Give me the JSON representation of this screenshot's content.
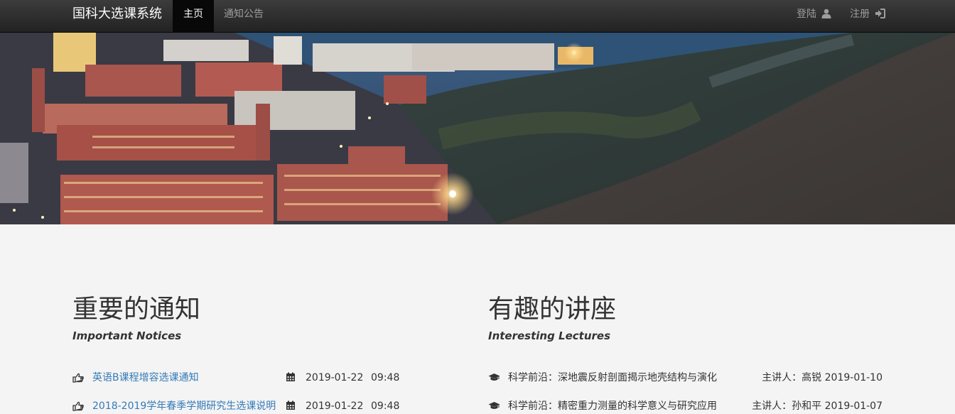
{
  "navbar": {
    "brand": "国科大选课系统",
    "items": [
      {
        "label": "主页",
        "active": true
      },
      {
        "label": "通知公告",
        "active": false
      }
    ],
    "login_label": "登陆",
    "register_label": "注册"
  },
  "notices": {
    "title": "重要的通知",
    "subtitle": "Important Notices",
    "items": [
      {
        "title": "英语B课程增容选课通知",
        "date": "2019-01-22",
        "time": "09:48"
      },
      {
        "title": "2018-2019学年春季学期研究生选课说明",
        "date": "2019-01-22",
        "time": "09:48"
      }
    ]
  },
  "lectures": {
    "title": "有趣的讲座",
    "subtitle": "Interesting Lectures",
    "items": [
      {
        "title": "科学前沿：深地震反射剖面揭示地壳结构与演化",
        "meta": "主讲人：高锐 2019-01-10"
      },
      {
        "title": "科学前沿：精密重力测量的科学意义与研究应用",
        "meta": "主讲人：孙和平 2019-01-07"
      }
    ]
  },
  "colors": {
    "link": "#337ab7",
    "navbar_bg": "#222222",
    "page_bg": "#f4f4f4"
  }
}
